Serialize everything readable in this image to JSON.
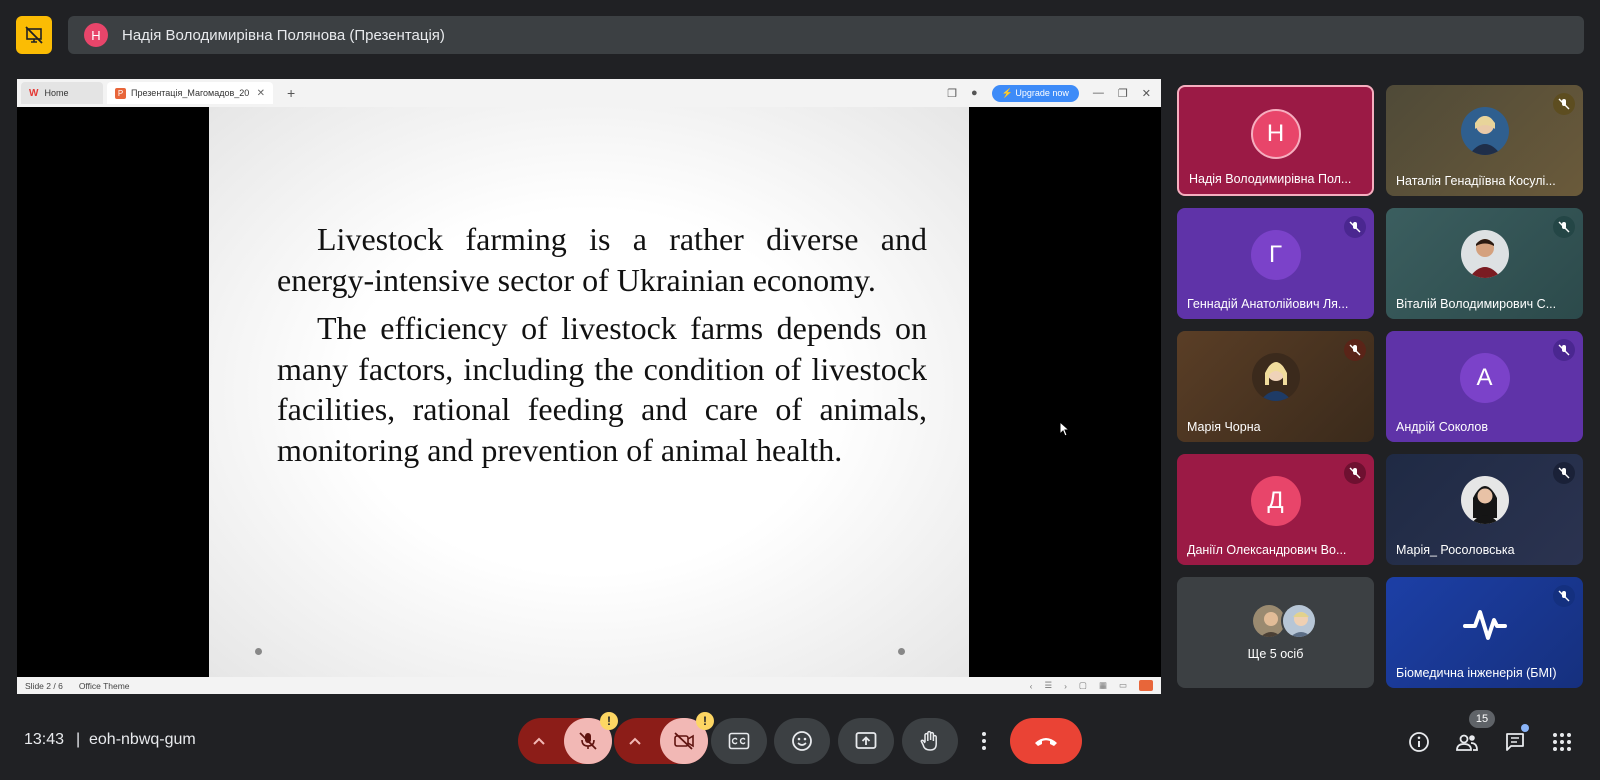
{
  "presenter": {
    "initial": "Н",
    "label": "Надія Володимирівна Полянова (Презентація)"
  },
  "ppt": {
    "tabs": [
      {
        "label": "Home"
      },
      {
        "label": "Презентація_Магомадов_20"
      }
    ],
    "upgrade_label": "⚡ Upgrade now",
    "status": {
      "slide": "Slide 2 / 6",
      "theme": "Office Theme"
    }
  },
  "slide": {
    "paragraphs": [
      "Livestock farming is a rather diverse and energy-intensive sector of Ukrainian economy.",
      "The efficiency of livestock farms depends on many factors, including the condition of livestock facilities, rational feeding and care of animals, monitoring and prevention of animal health."
    ]
  },
  "participants": [
    {
      "name": "Надія Володимирівна Пол...",
      "initial": "Н",
      "avatar_color": "#e8456a",
      "bg": "#9b1a45",
      "muted": false,
      "highlight": true,
      "photo": false
    },
    {
      "name": "Наталія Генадіївна Косулі...",
      "initial": "",
      "bg": "#5a4b30",
      "muted": true,
      "photo": true
    },
    {
      "name": "Геннадій Анатолійович Ля...",
      "initial": "Г",
      "avatar_color": "#7b42c9",
      "bg": "#5f33a8",
      "muted": true,
      "photo": false
    },
    {
      "name": "Віталій Володимирович С...",
      "initial": "",
      "bg": "#3b5e5f",
      "muted": true,
      "photo": true
    },
    {
      "name": "Марія Чорна",
      "initial": "",
      "bg": "#4a3422",
      "muted": true,
      "photo": true
    },
    {
      "name": "Андрій Соколов",
      "initial": "А",
      "avatar_color": "#7b42c9",
      "bg": "#5f33a8",
      "muted": true,
      "photo": false
    },
    {
      "name": "Даніїл Олександрович Во...",
      "initial": "Д",
      "avatar_color": "#e8456a",
      "bg": "#9b1a45",
      "muted": true,
      "photo": false
    },
    {
      "name": "Марія_ Росоловська",
      "initial": "",
      "bg": "#23304a",
      "muted": true,
      "photo": true
    },
    {
      "name": "Ще 5 осіб",
      "initial": "",
      "bg": "#3c4043",
      "muted": false,
      "photo": false
    },
    {
      "name": "Біомедична інженерія (БМІ)",
      "initial": "",
      "bg": "#1c3fa6",
      "muted": true,
      "photo": false
    }
  ],
  "bottom": {
    "time": "13:43",
    "separator": "|",
    "meeting_code": "eoh-nbwq-gum",
    "warning_mark": "!",
    "participant_count": "15"
  },
  "colors": {
    "accent_blue": "#8ab4f8",
    "end_call": "#ea4335",
    "warning": "#fdd663"
  }
}
